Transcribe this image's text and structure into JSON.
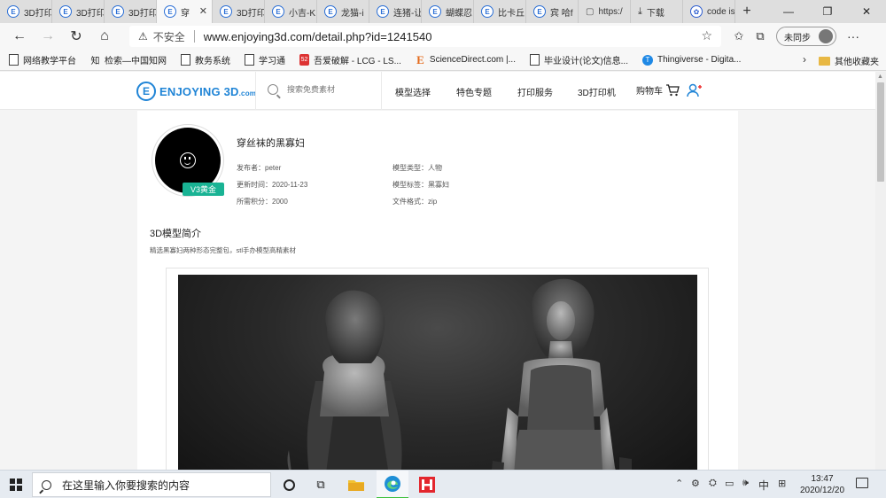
{
  "browser": {
    "tabs": [
      {
        "label": "3D打印"
      },
      {
        "label": "3D打印"
      },
      {
        "label": "3D打印"
      },
      {
        "label": "穿",
        "active": true
      },
      {
        "label": "3D打印"
      },
      {
        "label": "小吉-K"
      },
      {
        "label": "龙猫-i"
      },
      {
        "label": "连猪-让"
      },
      {
        "label": "蝴蝶忍"
      },
      {
        "label": "比卡丘"
      },
      {
        "label": "宾 哈f"
      },
      {
        "label": "https:/"
      },
      {
        "label": "下载"
      },
      {
        "label": "code is"
      }
    ],
    "tab_close_symbol": "✕",
    "new_tab_symbol": "+",
    "window_controls": {
      "minimize": "—",
      "maximize": "❐",
      "close": "✕"
    },
    "address": {
      "insecure_label": "不安全",
      "url": "www.enjoying3d.com/detail.php?id=1241540"
    },
    "sync_label": "未同步",
    "bookmarks": [
      {
        "label": "网络教学平台",
        "icon": "doc-icon"
      },
      {
        "label": "检索—中国知网",
        "icon": "cnki-icon"
      },
      {
        "label": "教务系统",
        "icon": "doc-icon"
      },
      {
        "label": "学习通",
        "icon": "doc-icon"
      },
      {
        "label": "吾爱破解 - LCG - LS...",
        "icon": "lcg-icon"
      },
      {
        "label": "ScienceDirect.com |...",
        "icon": "sciencedirect-icon"
      },
      {
        "label": "毕业设计(论文)信息...",
        "icon": "doc-icon"
      },
      {
        "label": "Thingiverse - Digita...",
        "icon": "thingiverse-icon"
      }
    ],
    "bookmarks_overflow": "›",
    "other_bookmarks": "其他收藏夹"
  },
  "site": {
    "logo_text": "ENJOYING 3D",
    "logo_suffix": ".com",
    "logo_letter": "E",
    "search_placeholder": "搜索免费素材",
    "nav": [
      "模型选择",
      "特色专题",
      "打印服务",
      "3D打印机",
      "购物车"
    ]
  },
  "model": {
    "title": "穿丝袜的黑寡妇",
    "badge": "V3黄金",
    "publisher": "发布者：peter",
    "updated": "更新时间：2020-11-23",
    "points": "所需积分：2000",
    "type": "模型类型：人物",
    "tags": "模型标签：黑寡妇",
    "format": "文件格式：zip",
    "section_title": "3D模型简介",
    "description": "精选黑寡妇两种形态完整包，stl手办模型高精素材"
  },
  "taskbar": {
    "search_placeholder": "在这里输入你要搜索的内容",
    "ime": "中",
    "time": "13:47",
    "date": "2020/12/20"
  },
  "colors": {
    "brand": "#1f84d6",
    "badge": "#19b394"
  }
}
